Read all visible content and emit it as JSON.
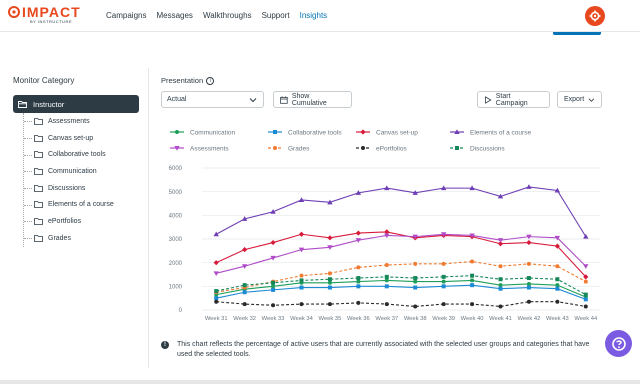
{
  "app": {
    "logo_text": "IMPACT",
    "logo_sub": "BY INSTRUCTURE"
  },
  "nav": {
    "items": [
      "Campaigns",
      "Messages",
      "Walkthroughs",
      "Support",
      "Insights"
    ],
    "active": "Insights"
  },
  "sidebar": {
    "title": "Monitor Category",
    "root": "Instructor",
    "items": [
      "Assessments",
      "Canvas set-up",
      "Collaborative tools",
      "Communication",
      "Discussions",
      "Elements of a course",
      "ePortfolios",
      "Grades"
    ]
  },
  "presentation": {
    "label": "Presentation",
    "select_value": "Actual",
    "show_cumulative": "Show Cumulative",
    "start_campaign": "Start Campaign",
    "export": "Export"
  },
  "colors": {
    "accent": "#0374b5",
    "brand": "#e8481d",
    "help": "#7b5be2",
    "sidebar_active": "#2d3b45"
  },
  "chart_data": {
    "type": "line",
    "categories": [
      "Week 31",
      "Week 32",
      "Week 33",
      "Week 34",
      "Week 35",
      "Week 36",
      "Week 37",
      "Week 38",
      "Week 39",
      "Week 40",
      "Week 41",
      "Week 42",
      "Week 43",
      "Week 44"
    ],
    "ylim": [
      0,
      6000
    ],
    "yticks": [
      0,
      1000,
      2000,
      3000,
      4000,
      5000,
      6000
    ],
    "grid": true,
    "legend_position": "top",
    "series": [
      {
        "name": "Communication",
        "color": "#1e9e5a",
        "marker": "circle",
        "dash": false,
        "values": [
          650,
          880,
          1000,
          1150,
          1150,
          1200,
          1250,
          1200,
          1200,
          1250,
          1050,
          1100,
          1050,
          550
        ]
      },
      {
        "name": "Collaborative tools",
        "color": "#1f8ad4",
        "marker": "square",
        "dash": false,
        "values": [
          500,
          750,
          850,
          950,
          950,
          1000,
          1000,
          950,
          1000,
          1050,
          900,
          950,
          900,
          450
        ]
      },
      {
        "name": "Canvas set-up",
        "color": "#d81b3a",
        "marker": "diamond",
        "dash": false,
        "values": [
          2000,
          2550,
          2850,
          3200,
          3050,
          3250,
          3300,
          3050,
          3150,
          3100,
          2800,
          2850,
          2700,
          1400
        ]
      },
      {
        "name": "Elements of a course",
        "color": "#6f3fb5",
        "marker": "triangle",
        "dash": false,
        "values": [
          3200,
          3850,
          4150,
          4650,
          4550,
          4950,
          5150,
          4950,
          5150,
          5150,
          4800,
          5200,
          5050,
          3100
        ]
      },
      {
        "name": "Assessments",
        "color": "#b04cc8",
        "marker": "triangle-down",
        "dash": false,
        "values": [
          1550,
          1850,
          2200,
          2550,
          2650,
          2950,
          3150,
          3100,
          3200,
          3150,
          2950,
          3100,
          3050,
          1850
        ]
      },
      {
        "name": "Grades",
        "color": "#ef7a30",
        "marker": "circle",
        "dash": true,
        "values": [
          750,
          950,
          1200,
          1450,
          1550,
          1800,
          1900,
          1950,
          1950,
          2050,
          1850,
          1950,
          1850,
          1200
        ]
      },
      {
        "name": "ePortfolios",
        "color": "#2a2a2a",
        "marker": "circle",
        "dash": true,
        "values": [
          350,
          250,
          200,
          250,
          250,
          300,
          250,
          150,
          250,
          250,
          150,
          350,
          350,
          150
        ]
      },
      {
        "name": "Discussions",
        "color": "#16875a",
        "marker": "square",
        "dash": true,
        "values": [
          800,
          1050,
          1150,
          1250,
          1300,
          1350,
          1400,
          1350,
          1400,
          1450,
          1300,
          1350,
          1300,
          650
        ]
      }
    ]
  },
  "note": "This chart reflects the percentage of active users that are currently associated with the selected user groups and categories that have used the selected tools."
}
